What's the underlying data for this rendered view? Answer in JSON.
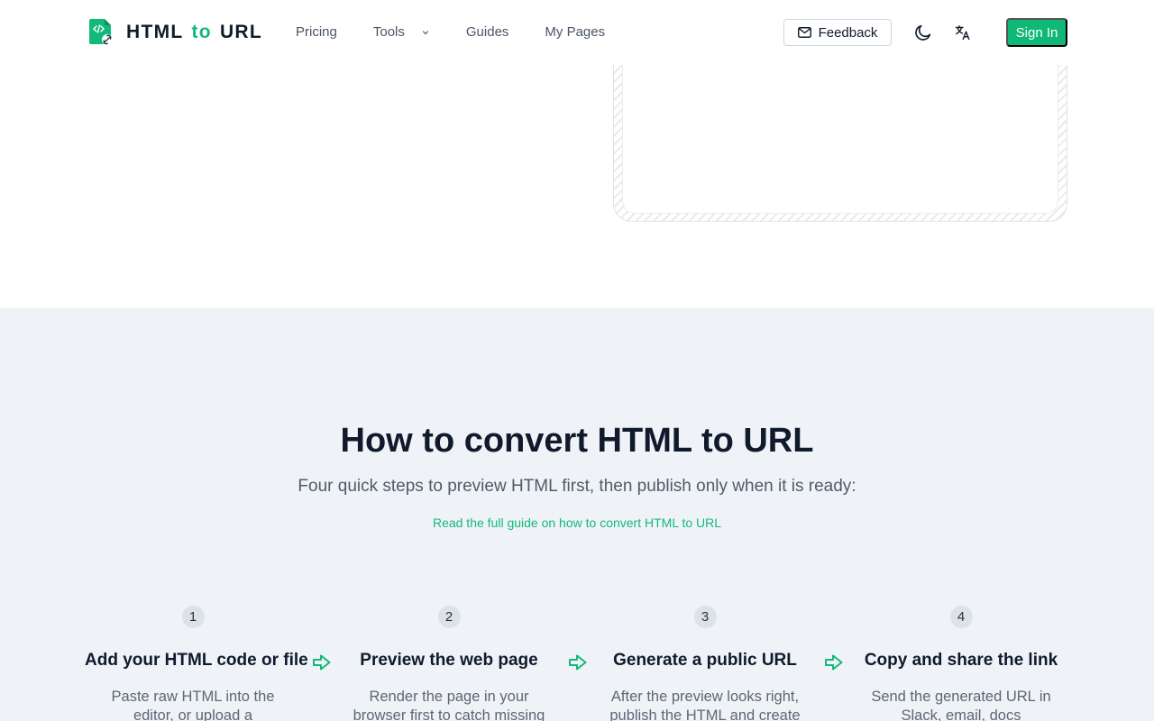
{
  "header": {
    "logo": {
      "word1": "HTML",
      "word2": "to",
      "word3": "URL"
    },
    "nav": [
      {
        "label": "Pricing"
      },
      {
        "label": "Tools"
      },
      {
        "label": "Guides"
      },
      {
        "label": "My Pages"
      }
    ],
    "feedback_label": "Feedback",
    "signin_label": "Sign In"
  },
  "howto": {
    "title": "How to convert HTML to URL",
    "subtitle": "Four quick steps to preview HTML first, then publish only when it is ready:",
    "guide_link": "Read the full guide on how to convert HTML to URL",
    "steps": [
      {
        "number": "1",
        "title": "Add your HTML code or file",
        "desc": "Paste raw HTML into the editor, or upload a"
      },
      {
        "number": "2",
        "title": "Preview the web page",
        "desc": "Render the page in your browser first to catch missing"
      },
      {
        "number": "3",
        "title": "Generate a public URL",
        "desc": "After the preview looks right, publish the HTML and create"
      },
      {
        "number": "4",
        "title": "Copy and share the link",
        "desc": "Send the generated URL in Slack, email, docs"
      }
    ]
  },
  "colors": {
    "accent": "#14b87a",
    "section_bg": "#eff3f8",
    "text": "#101a2c"
  },
  "icons": [
    "logo-file-link-icon",
    "chevron-down-icon",
    "mail-icon",
    "moon-icon",
    "translate-icon",
    "arrow-right-icon"
  ]
}
